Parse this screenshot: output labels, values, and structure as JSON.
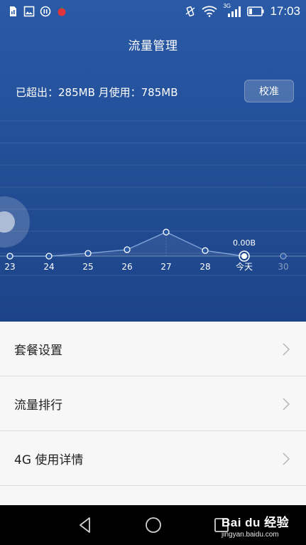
{
  "status_bar": {
    "time": "17:03",
    "network": "3G",
    "left_icons": [
      "sim-alert-icon",
      "image-icon",
      "pause-icon",
      "red-app-icon"
    ],
    "right_icons": [
      "vibrate-icon",
      "wifi-icon",
      "signal-icon",
      "battery-icon"
    ]
  },
  "header": {
    "title": "流量管理"
  },
  "usage": {
    "summary": "已超出：285MB 月使用：785MB",
    "calibrate_label": "校准"
  },
  "chart_data": {
    "type": "line",
    "categories": [
      "23",
      "24",
      "25",
      "26",
      "27",
      "28",
      "今天",
      "30"
    ],
    "values": [
      0,
      0,
      0.15,
      0.35,
      1.3,
      0.3,
      0,
      null
    ],
    "ylim": [
      0,
      4
    ],
    "selected_label": "0.00B",
    "selected_index": 6,
    "grid": true,
    "colors": {
      "line": "#7fa2d6",
      "point": "#ffffff"
    }
  },
  "list": {
    "items": [
      {
        "label": "套餐设置"
      },
      {
        "label": "流量排行"
      },
      {
        "label": "4G 使用详情"
      }
    ]
  },
  "watermark": {
    "logo": "Bai du 经验",
    "url": "jingyan.baidu.com"
  }
}
